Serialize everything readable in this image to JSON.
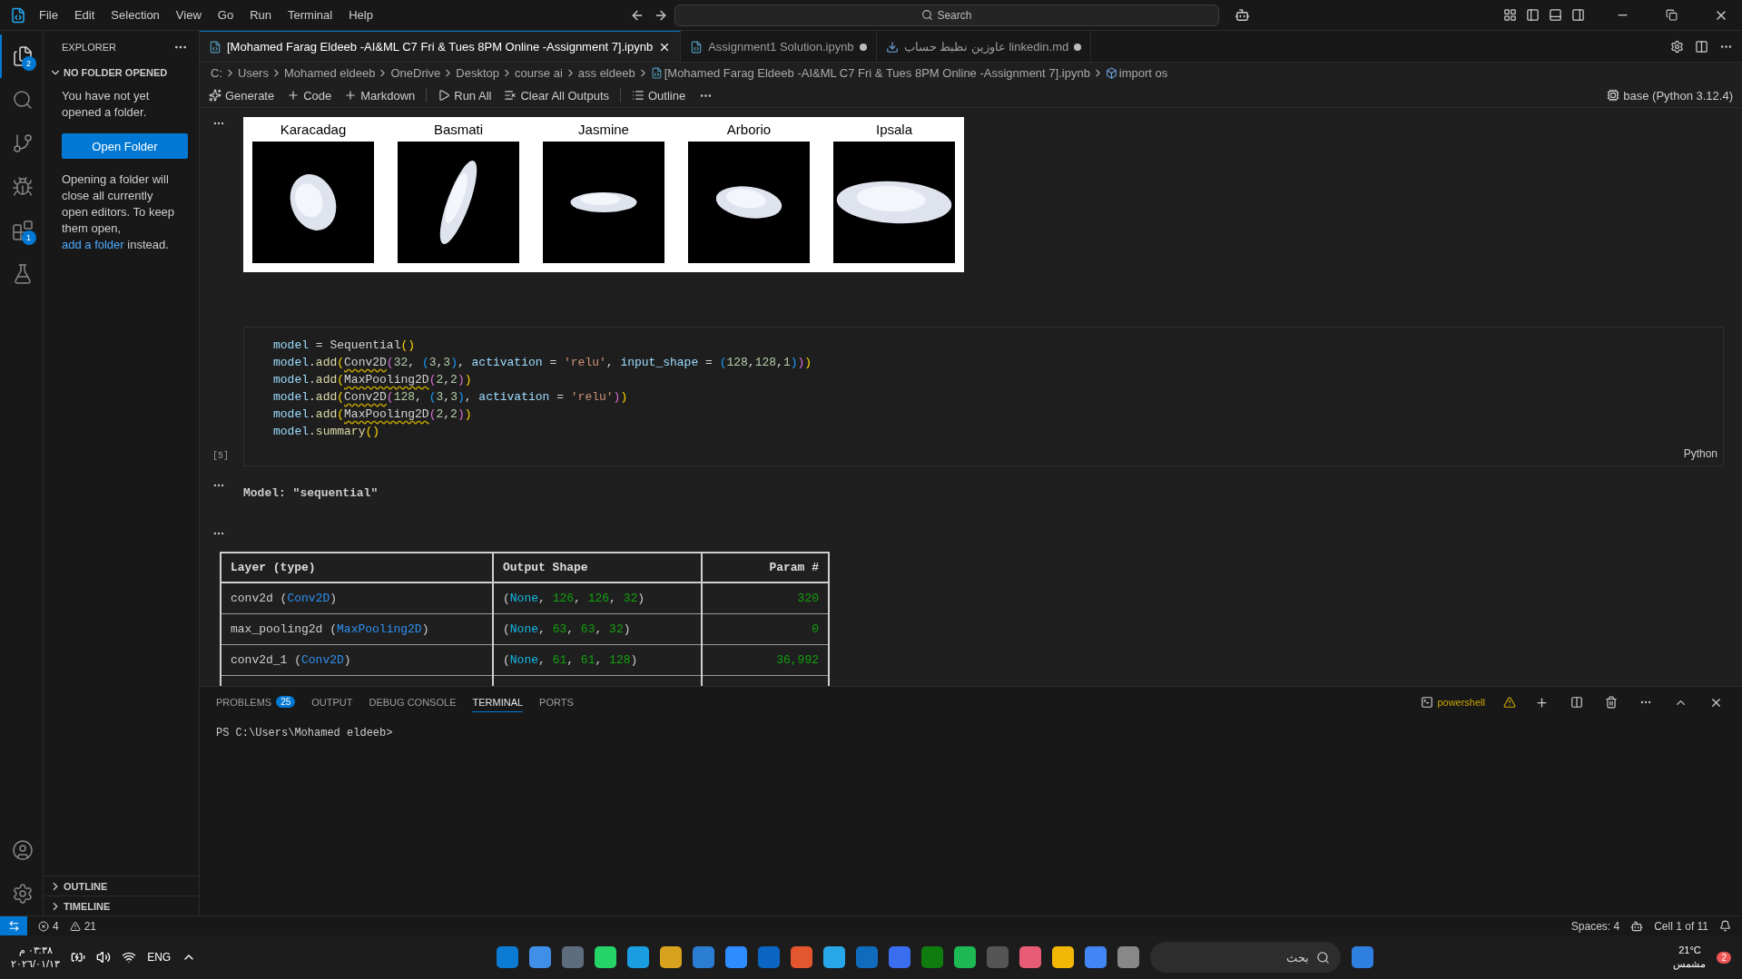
{
  "menu": [
    "File",
    "Edit",
    "Selection",
    "View",
    "Go",
    "Run",
    "Terminal",
    "Help"
  ],
  "search": {
    "placeholder": "Search"
  },
  "activity_bar": [
    {
      "kind": "explorer",
      "selected": true,
      "badge": "2"
    },
    {
      "kind": "search",
      "selected": false
    },
    {
      "kind": "source-control",
      "selected": false
    },
    {
      "kind": "run-debug",
      "selected": false
    },
    {
      "kind": "extensions",
      "selected": false,
      "badge": "1"
    },
    {
      "kind": "testing",
      "selected": false
    }
  ],
  "sidebar": {
    "title": "EXPLORER",
    "section": "NO FOLDER OPENED",
    "message": "You have not yet opened a folder.",
    "button": "Open Folder",
    "note_before": "Opening a folder will close all currently open editors. To keep them open, ",
    "link": "add a folder",
    "note_after": " instead.",
    "bottom_sections": [
      "OUTLINE",
      "TIMELINE"
    ]
  },
  "tabs": [
    {
      "label": "[Mohamed Farag Eldeeb -AI&ML C7 Fri & Tues 8PM Online -Assignment 7].ipynb",
      "kind": "notebook",
      "selected": true,
      "modified": false
    },
    {
      "label": "Assignment1 Solution.ipynb",
      "kind": "notebook",
      "selected": false,
      "modified": true
    },
    {
      "label": "عاوزين نظبط حساب linkedin.md",
      "kind": "markdown",
      "selected": false,
      "modified": true
    }
  ],
  "breadcrumb": [
    "C:",
    "Users",
    "Mohamed eldeeb",
    "OneDrive",
    "Desktop",
    "course ai",
    "ass eldeeb",
    "[Mohamed Farag Eldeeb -AI&ML C7 Fri & Tues 8PM Online -Assignment 7].ipynb",
    "import os"
  ],
  "toolbar": [
    {
      "kind": "generate",
      "label": "Generate"
    },
    {
      "kind": "add",
      "label": "Code"
    },
    {
      "kind": "add",
      "label": "Markdown"
    },
    {
      "kind": "run",
      "label": "Run All"
    },
    {
      "kind": "clear",
      "label": "Clear All Outputs"
    },
    {
      "kind": "outline",
      "label": "Outline"
    }
  ],
  "kernel": "base (Python 3.12.4)",
  "image_output": [
    {
      "label": "Karacadag",
      "kind": "picture"
    },
    {
      "label": "Basmati",
      "kind": "picture"
    },
    {
      "label": "Jasmine",
      "kind": "picture"
    },
    {
      "label": "Arborio",
      "kind": "picture"
    },
    {
      "label": "Ipsala",
      "kind": "picture"
    }
  ],
  "code_cell": {
    "execution": "[5]",
    "language": "Python",
    "lines": [
      [
        {
          "t": "model",
          "kind": "var"
        },
        {
          "t": " = ",
          "kind": "plain"
        },
        {
          "t": "Sequential",
          "kind": "plain"
        },
        {
          "t": "()",
          "kind": "p1"
        }
      ],
      [
        {
          "t": "model",
          "kind": "var"
        },
        {
          "t": ".",
          "kind": "plain"
        },
        {
          "t": "add",
          "kind": "func"
        },
        {
          "t": "(",
          "kind": "p1"
        },
        {
          "t": "Conv2D",
          "kind": "warn"
        },
        {
          "t": "(",
          "kind": "p2"
        },
        {
          "t": "32",
          "kind": "num"
        },
        {
          "t": ", ",
          "kind": "plain"
        },
        {
          "t": "(",
          "kind": "p3"
        },
        {
          "t": "3",
          "kind": "num"
        },
        {
          "t": ",",
          "kind": "plain"
        },
        {
          "t": "3",
          "kind": "num"
        },
        {
          "t": ")",
          "kind": "p3"
        },
        {
          "t": ", ",
          "kind": "plain"
        },
        {
          "t": "activation",
          "kind": "var"
        },
        {
          "t": " = ",
          "kind": "plain"
        },
        {
          "t": "'relu'",
          "kind": "str"
        },
        {
          "t": ", ",
          "kind": "plain"
        },
        {
          "t": "input_shape",
          "kind": "var"
        },
        {
          "t": " = ",
          "kind": "plain"
        },
        {
          "t": "(",
          "kind": "p3"
        },
        {
          "t": "128",
          "kind": "num"
        },
        {
          "t": ",",
          "kind": "plain"
        },
        {
          "t": "128",
          "kind": "num"
        },
        {
          "t": ",",
          "kind": "plain"
        },
        {
          "t": "1",
          "kind": "num"
        },
        {
          "t": ")",
          "kind": "p3"
        },
        {
          "t": ")",
          "kind": "p2"
        },
        {
          "t": ")",
          "kind": "p1"
        }
      ],
      [
        {
          "t": "model",
          "kind": "var"
        },
        {
          "t": ".",
          "kind": "plain"
        },
        {
          "t": "add",
          "kind": "func"
        },
        {
          "t": "(",
          "kind": "p1"
        },
        {
          "t": "MaxPooling2D",
          "kind": "warn"
        },
        {
          "t": "(",
          "kind": "p2"
        },
        {
          "t": "2",
          "kind": "num"
        },
        {
          "t": ",",
          "kind": "plain"
        },
        {
          "t": "2",
          "kind": "num"
        },
        {
          "t": ")",
          "kind": "p2"
        },
        {
          "t": ")",
          "kind": "p1"
        }
      ],
      [
        {
          "t": "model",
          "kind": "var"
        },
        {
          "t": ".",
          "kind": "plain"
        },
        {
          "t": "add",
          "kind": "func"
        },
        {
          "t": "(",
          "kind": "p1"
        },
        {
          "t": "Conv2D",
          "kind": "warn"
        },
        {
          "t": "(",
          "kind": "p2"
        },
        {
          "t": "128",
          "kind": "num"
        },
        {
          "t": ", ",
          "kind": "plain"
        },
        {
          "t": "(",
          "kind": "p3"
        },
        {
          "t": "3",
          "kind": "num"
        },
        {
          "t": ",",
          "kind": "plain"
        },
        {
          "t": "3",
          "kind": "num"
        },
        {
          "t": ")",
          "kind": "p3"
        },
        {
          "t": ", ",
          "kind": "plain"
        },
        {
          "t": "activation",
          "kind": "var"
        },
        {
          "t": " = ",
          "kind": "plain"
        },
        {
          "t": "'relu'",
          "kind": "str"
        },
        {
          "t": ")",
          "kind": "p2"
        },
        {
          "t": ")",
          "kind": "p1"
        }
      ],
      [
        {
          "t": "model",
          "kind": "var"
        },
        {
          "t": ".",
          "kind": "plain"
        },
        {
          "t": "add",
          "kind": "func"
        },
        {
          "t": "(",
          "kind": "p1"
        },
        {
          "t": "MaxPooling2D",
          "kind": "warn"
        },
        {
          "t": "(",
          "kind": "p2"
        },
        {
          "t": "2",
          "kind": "num"
        },
        {
          "t": ",",
          "kind": "plain"
        },
        {
          "t": "2",
          "kind": "num"
        },
        {
          "t": ")",
          "kind": "p2"
        },
        {
          "t": ")",
          "kind": "p1"
        }
      ],
      [
        {
          "t": "model",
          "kind": "var"
        },
        {
          "t": ".",
          "kind": "plain"
        },
        {
          "t": "summary",
          "kind": "func"
        },
        {
          "t": "()",
          "kind": "p1"
        }
      ]
    ]
  },
  "model_output": "Model: \"sequential\"",
  "summary_table": {
    "columns": [
      "Layer (type)",
      "Output Shape",
      "Param #"
    ],
    "rows": [
      {
        "layer": [
          {
            "t": "conv2d (",
            "kind": "plain"
          },
          {
            "t": "Conv2D",
            "kind": "type"
          },
          {
            "t": ")",
            "kind": "plain"
          }
        ],
        "shape": [
          {
            "t": "(",
            "kind": "plain"
          },
          {
            "t": "None",
            "kind": "none"
          },
          {
            "t": ", ",
            "kind": "plain"
          },
          {
            "t": "126",
            "kind": "num"
          },
          {
            "t": ", ",
            "kind": "plain"
          },
          {
            "t": "126",
            "kind": "num"
          },
          {
            "t": ", ",
            "kind": "plain"
          },
          {
            "t": "32",
            "kind": "num"
          },
          {
            "t": ")",
            "kind": "plain"
          }
        ],
        "params": "320"
      },
      {
        "layer": [
          {
            "t": "max_pooling2d (",
            "kind": "plain"
          },
          {
            "t": "MaxPooling2D",
            "kind": "type"
          },
          {
            "t": ")",
            "kind": "plain"
          }
        ],
        "shape": [
          {
            "t": "(",
            "kind": "plain"
          },
          {
            "t": "None",
            "kind": "none"
          },
          {
            "t": ", ",
            "kind": "plain"
          },
          {
            "t": "63",
            "kind": "num"
          },
          {
            "t": ", ",
            "kind": "plain"
          },
          {
            "t": "63",
            "kind": "num"
          },
          {
            "t": ", ",
            "kind": "plain"
          },
          {
            "t": "32",
            "kind": "num"
          },
          {
            "t": ")",
            "kind": "plain"
          }
        ],
        "params": "0"
      },
      {
        "layer": [
          {
            "t": "conv2d_1 (",
            "kind": "plain"
          },
          {
            "t": "Conv2D",
            "kind": "type"
          },
          {
            "t": ")",
            "kind": "plain"
          }
        ],
        "shape": [
          {
            "t": "(",
            "kind": "plain"
          },
          {
            "t": "None",
            "kind": "none"
          },
          {
            "t": ", ",
            "kind": "plain"
          },
          {
            "t": "61",
            "kind": "num"
          },
          {
            "t": ", ",
            "kind": "plain"
          },
          {
            "t": "61",
            "kind": "num"
          },
          {
            "t": ", ",
            "kind": "plain"
          },
          {
            "t": "128",
            "kind": "num"
          },
          {
            "t": ")",
            "kind": "plain"
          }
        ],
        "params": "36,992"
      }
    ]
  },
  "panel": {
    "tabs": [
      {
        "label": "PROBLEMS",
        "selected": false,
        "badge": "25"
      },
      {
        "label": "OUTPUT",
        "selected": false
      },
      {
        "label": "DEBUG CONSOLE",
        "selected": false
      },
      {
        "label": "TERMINAL",
        "selected": true
      },
      {
        "label": "PORTS",
        "selected": false
      }
    ],
    "shell": "powershell",
    "prompt": "PS C:\\Users\\Mohamed eldeeb>"
  },
  "status_bar": {
    "errors": "4",
    "warnings": "21",
    "spaces": "Spaces: 4",
    "cell": "Cell 1 of 11"
  },
  "taskbar": {
    "clock_time": "٠٣:٣٨ م",
    "clock_date": "٢٠٢٦/٠١/١٣",
    "language": "ENG",
    "search_placeholder": "بحث",
    "temperature": "21°C",
    "weather": "مشمس",
    "notifications": "2"
  }
}
